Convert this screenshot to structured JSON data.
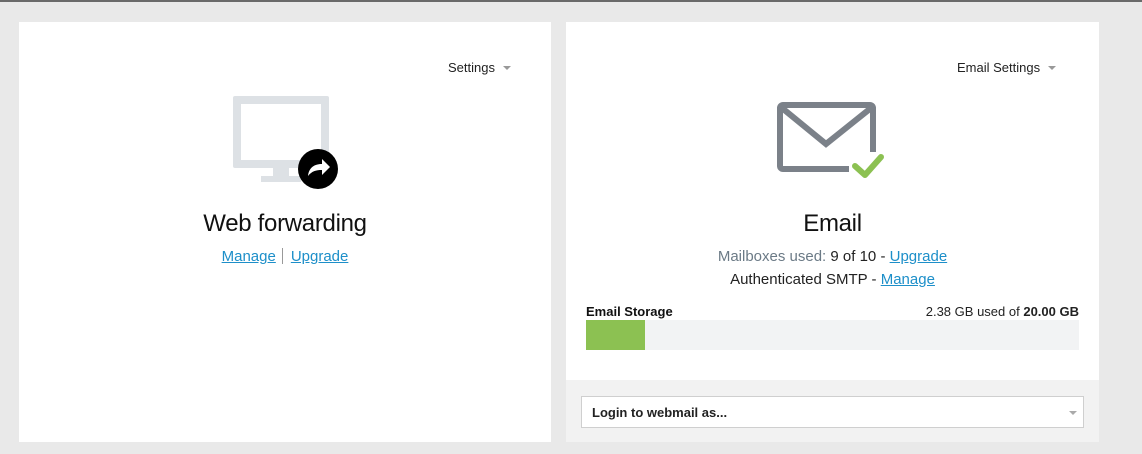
{
  "web_card": {
    "settings_label": "Settings",
    "title": "Web forwarding",
    "manage_link": "Manage",
    "upgrade_link": "Upgrade"
  },
  "email_card": {
    "settings_label": "Email Settings",
    "title": "Email",
    "mailboxes_label": "Mailboxes used:",
    "mailboxes_value": "9 of 10",
    "dash": "-",
    "upgrade_link": "Upgrade",
    "smtp_label": "Authenticated SMTP",
    "smtp_dash": "-",
    "smtp_manage_link": "Manage",
    "storage_label": "Email Storage",
    "storage_used": "2.38 GB",
    "storage_used_of": "used of",
    "storage_total": "20.00 GB",
    "storage_fraction": 0.119,
    "webmail_select_value": "Login to webmail as..."
  },
  "colors": {
    "link": "#1d8fc9",
    "storage_fill": "#8cc152",
    "check": "#8cc152",
    "icon_gray": "#7b8189"
  },
  "icons": {
    "web": "monitor-forward-icon",
    "email": "envelope-check-icon"
  }
}
